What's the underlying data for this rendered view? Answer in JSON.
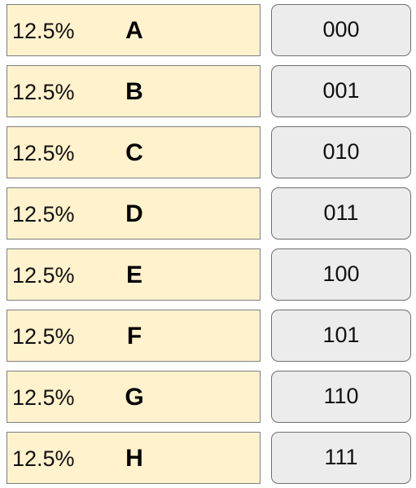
{
  "colors": {
    "symbol_fill": "#fff2cc",
    "code_fill": "#ececec",
    "border": "#7f7f7f"
  },
  "rows": [
    {
      "prob": "12.5%",
      "symbol": "A",
      "code": "000"
    },
    {
      "prob": "12.5%",
      "symbol": "B",
      "code": "001"
    },
    {
      "prob": "12.5%",
      "symbol": "C",
      "code": "010"
    },
    {
      "prob": "12.5%",
      "symbol": "D",
      "code": "011"
    },
    {
      "prob": "12.5%",
      "symbol": "E",
      "code": "100"
    },
    {
      "prob": "12.5%",
      "symbol": "F",
      "code": "101"
    },
    {
      "prob": "12.5%",
      "symbol": "G",
      "code": "110"
    },
    {
      "prob": "12.5%",
      "symbol": "H",
      "code": "111"
    }
  ]
}
